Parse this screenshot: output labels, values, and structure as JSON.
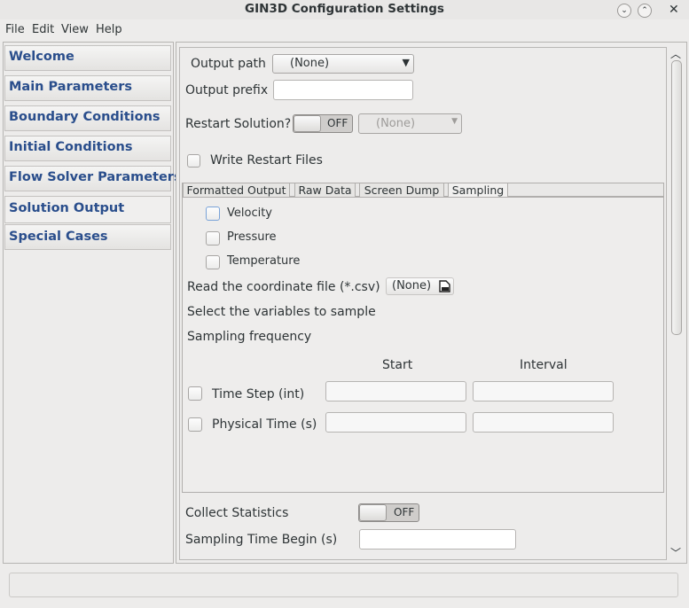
{
  "window": {
    "title": "GIN3D Configuration Settings"
  },
  "menu": [
    "File",
    "Edit",
    "View",
    "Help"
  ],
  "sidebar": {
    "items": [
      {
        "label": "Welcome"
      },
      {
        "label": "Main Parameters"
      },
      {
        "label": "Boundary Conditions"
      },
      {
        "label": "Initial Conditions"
      },
      {
        "label": "Flow Solver Parameters"
      },
      {
        "label": "Solution Output"
      },
      {
        "label": "Special Cases"
      }
    ]
  },
  "output": {
    "path_label": "Output path",
    "path_value": "(None)",
    "prefix_label": "Output prefix",
    "prefix_value": "",
    "restart_label": "Restart Solution?",
    "restart_toggle": "OFF",
    "restart_file": "(None)",
    "write_restart_label": "Write Restart Files"
  },
  "tabs": [
    {
      "label": "Formatted Output"
    },
    {
      "label": "Raw Data"
    },
    {
      "label": "Screen Dump"
    },
    {
      "label": "Sampling",
      "active": true
    }
  ],
  "sampling": {
    "variables": [
      {
        "label": "Velocity"
      },
      {
        "label": "Pressure"
      },
      {
        "label": "Temperature"
      }
    ],
    "coord_label": "Read the coordinate file (*.csv)",
    "coord_value": "(None)",
    "select_label": "Select the variables to sample",
    "freq_label": "Sampling frequency",
    "col_start": "Start",
    "col_interval": "Interval",
    "rows": [
      {
        "label": "Time Step (int)",
        "start": "",
        "interval": ""
      },
      {
        "label": "Physical Time (s)",
        "start": "",
        "interval": ""
      }
    ]
  },
  "stats": {
    "collect_label": "Collect Statistics",
    "collect_toggle": "OFF",
    "begin_label": "Sampling Time Begin (s)",
    "begin_value": ""
  },
  "icons": {
    "minimize": "chevron-down-icon",
    "maximize": "chevron-up-icon",
    "close": "close-icon",
    "file_open": "open-file-icon"
  }
}
